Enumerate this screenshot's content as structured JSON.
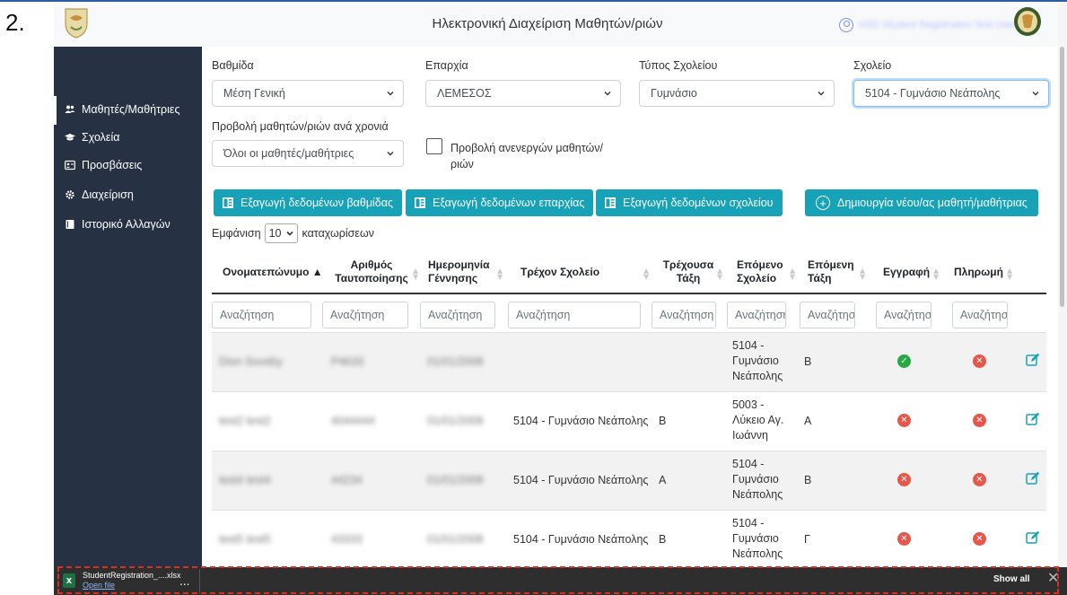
{
  "step_number": "2.",
  "header": {
    "title": "Ηλεκτρονική Διαχείριση Μαθητών/ριών",
    "user_name": "HSD Student Registration Test User"
  },
  "sidebar": {
    "items": [
      {
        "label": "Μαθητές/Μαθήτριες",
        "icon": "users-icon",
        "active": true
      },
      {
        "label": "Σχολεία",
        "icon": "graduation-cap-icon"
      },
      {
        "label": "Προσβάσεις",
        "icon": "id-card-icon"
      },
      {
        "label": "Διαχείριση",
        "icon": "gear-icon"
      },
      {
        "label": "Ιστορικό Αλλαγών",
        "icon": "book-icon"
      }
    ]
  },
  "filters": {
    "level_label": "Βαθμίδα",
    "level_value": "Μέση Γενική",
    "district_label": "Επαρχία",
    "district_value": "ΛΕΜΕΣΟΣ",
    "school_type_label": "Τύπος Σχολείου",
    "school_type_value": "Γυμνάσιο",
    "school_label": "Σχολείο",
    "school_value": "5104 - Γυμνάσιο Νεάπολης",
    "year_view_label": "Προβολή μαθητών/ριών ανά χρονιά",
    "year_view_value": "Όλοι οι μαθητές/μαθήτριες",
    "inactive_line1": "Προβολή ανενεργών μαθητών/",
    "inactive_line2": "ριών"
  },
  "actions": {
    "export_level": "Εξαγωγή δεδομένων βαθμίδας",
    "export_district": "Εξαγωγή δεδομένων επαρχίας",
    "export_school": "Εξαγωγή δεδομένων σχολείου",
    "create_student": "Δημιουργία νέου/ας μαθητή/μαθήτριας"
  },
  "entries": {
    "show_label": "Εμφάνιση",
    "count": "10",
    "entries_label": "καταχωρίσεων"
  },
  "table": {
    "headers": {
      "name": "Ονοματεπώνυμο",
      "id_line1": "Αριθμός",
      "id_line2": "Ταυτοποίησης",
      "dob_line1": "Ημερομηνία",
      "dob_line2": "Γέννησης",
      "current_school": "Τρέχον Σχολείο",
      "current_class_line1": "Τρέχουσα",
      "current_class_line2": "Τάξη",
      "next_school_line1": "Επόμενο",
      "next_school_line2": "Σχολείο",
      "next_class_line1": "Επόμενη",
      "next_class_line2": "Τάξη",
      "registration": "Εγγραφή",
      "payment": "Πληρωμή"
    },
    "search_placeholders": [
      "Αναζήτηση",
      "Αναζήτηση",
      "Αναζήτηση",
      "Αναζήτηση",
      "Αναζήτηση",
      "Αναζήτηση",
      "Αναζήτηση",
      "Αναζήτηση",
      "Αναζήτηση"
    ],
    "rows": [
      {
        "name": "Dion Soveby",
        "id": "P4633",
        "dob": "01/01/2008",
        "current_school": "",
        "current_class": "",
        "next_school_1": "5104 -",
        "next_school_2": "Γυμνάσιο",
        "next_school_3": "Νεάπολης",
        "next_class": "Β",
        "registration": "ok",
        "payment": "no"
      },
      {
        "name": "test2 test2",
        "id": "4044444",
        "dob": "01/01/2008",
        "current_school": "5104 - Γυμνάσιο Νεάπολης",
        "current_class": "Β",
        "next_school_1": "5003 -",
        "next_school_2": "Λύκειο Αγ.",
        "next_school_3": "Ιωάννη",
        "next_class": "Α",
        "registration": "no",
        "payment": "no"
      },
      {
        "name": "test4 test4",
        "id": "44234",
        "dob": "01/01/2008",
        "current_school": "5104 - Γυμνάσιο Νεάπολης",
        "current_class": "Α",
        "next_school_1": "5104 -",
        "next_school_2": "Γυμνάσιο",
        "next_school_3": "Νεάπολης",
        "next_class": "Β",
        "registration": "no",
        "payment": "no"
      },
      {
        "name": "test5 test5",
        "id": "43333",
        "dob": "01/01/2008",
        "current_school": "5104 - Γυμνάσιο Νεάπολης",
        "current_class": "Β",
        "next_school_1": "5104 -",
        "next_school_2": "Γυμνάσιο",
        "next_school_3": "Νεάπολης",
        "next_class": "Γ",
        "registration": "no",
        "payment": "no"
      }
    ]
  },
  "download_bar": {
    "file_name": "StudentRegistration_....xlsx",
    "open_label": "Open file",
    "more": "...",
    "show_all": "Show all",
    "close": "✕"
  },
  "colors": {
    "sidebar_bg": "#263143",
    "button_teal": "#17a2b8",
    "status_ok": "#28a745",
    "status_no": "#e4574a",
    "edit_icon": "#17a2b8"
  }
}
